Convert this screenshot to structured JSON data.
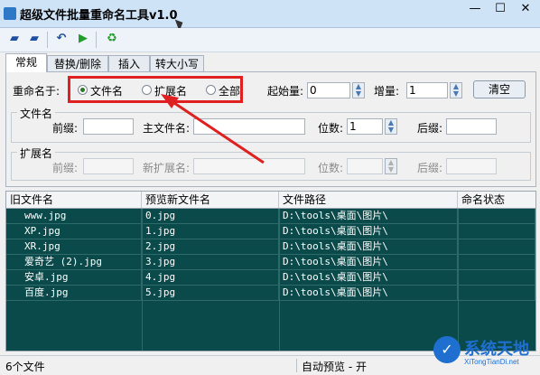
{
  "window": {
    "title": "超级文件批量重命名工具v1.0",
    "min": "—",
    "max": "☐",
    "close": "✕"
  },
  "toolbar": {
    "icons": [
      "open-folder-icon",
      "open-file-icon",
      "undo-icon",
      "run-icon",
      "refresh-icon"
    ]
  },
  "tabs": [
    {
      "label": "常规",
      "active": true
    },
    {
      "label": "替换/删除",
      "active": false
    },
    {
      "label": "插入",
      "active": false
    },
    {
      "label": "转大小写",
      "active": false
    }
  ],
  "rename": {
    "label": "重命名于:",
    "options": [
      {
        "label": "文件名",
        "checked": true
      },
      {
        "label": "扩展名",
        "checked": false
      },
      {
        "label": "全部",
        "checked": false
      }
    ],
    "start_label": "起始量:",
    "start_value": "0",
    "step_label": "增量:",
    "step_value": "1",
    "clear_label": "清空"
  },
  "filename_group": {
    "title": "文件名",
    "prefix_label": "前缀:",
    "prefix_value": "",
    "main_label": "主文件名:",
    "main_value": "",
    "digits_label": "位数:",
    "digits_value": "1",
    "suffix_label": "后缀:",
    "suffix_value": ""
  },
  "ext_group": {
    "title": "扩展名",
    "prefix_label": "前缀:",
    "new_ext_label": "新扩展名:",
    "digits_label": "位数:",
    "suffix_label": "后缀:"
  },
  "table": {
    "columns": [
      "旧文件名",
      "预览新文件名",
      "文件路径",
      "命名状态"
    ],
    "rows": [
      [
        "www.jpg",
        "0.jpg",
        "D:\\tools\\桌面\\图片\\",
        ""
      ],
      [
        "XP.jpg",
        "1.jpg",
        "D:\\tools\\桌面\\图片\\",
        ""
      ],
      [
        "XR.jpg",
        "2.jpg",
        "D:\\tools\\桌面\\图片\\",
        ""
      ],
      [
        "爱奇艺 (2).jpg",
        "3.jpg",
        "D:\\tools\\桌面\\图片\\",
        ""
      ],
      [
        "安卓.jpg",
        "4.jpg",
        "D:\\tools\\桌面\\图片\\",
        ""
      ],
      [
        "百度.jpg",
        "5.jpg",
        "D:\\tools\\桌面\\图片\\",
        ""
      ]
    ]
  },
  "status": {
    "count": "6个文件",
    "preview": "自动预览 - 开"
  },
  "watermark": {
    "name": "系统天地",
    "url": "XiTongTianDi.net"
  },
  "colors": {
    "table_bg": "#0b4a4a",
    "highlight": "#e02020"
  }
}
